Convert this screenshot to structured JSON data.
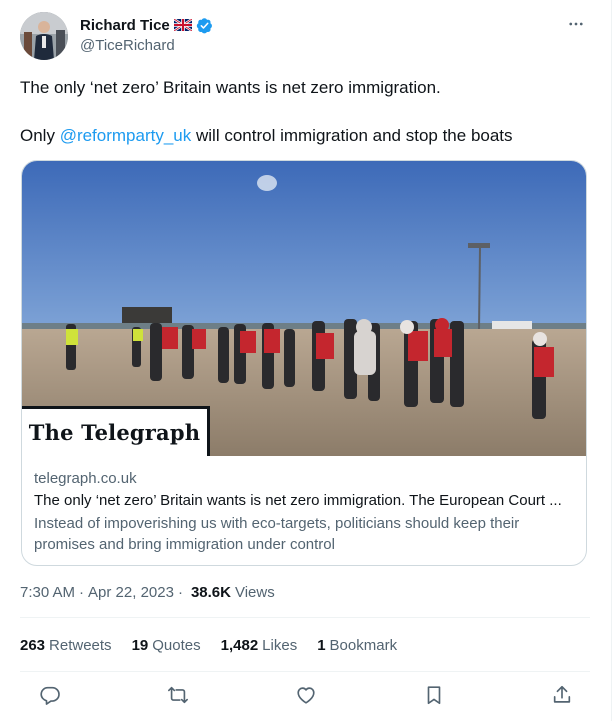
{
  "author": {
    "display_name": "Richard Tice",
    "handle": "@TiceRichard",
    "flag_icon": "union-jack-flag-icon",
    "verified_icon": "verified-badge-icon"
  },
  "tweet": {
    "line1": "The only ‘net zero’ Britain wants is net zero immigration.",
    "line2_prefix": "Only ",
    "line2_mention": "@reformparty_uk",
    "line2_suffix": " will control immigration and stop the boats"
  },
  "card": {
    "publication_label": "The Telegraph",
    "domain": "telegraph.co.uk",
    "title": "The only ‘net zero’ Britain wants is net zero immigration. The European Court ...",
    "description": "Instead of impoverishing us with eco-targets, politicians should keep their promises and bring immigration under control"
  },
  "meta": {
    "time": "7:30 AM",
    "date": "Apr 22, 2023",
    "separator": "·",
    "views_count": "38.6K",
    "views_label": "Views"
  },
  "stats": {
    "retweets_count": "263",
    "retweets_label": "Retweets",
    "quotes_count": "19",
    "quotes_label": "Quotes",
    "likes_count": "1,482",
    "likes_label": "Likes",
    "bookmarks_count": "1",
    "bookmarks_label": "Bookmark"
  },
  "actions": {
    "reply_icon": "reply-icon",
    "retweet_icon": "retweet-icon",
    "like_icon": "heart-icon",
    "bookmark_icon": "bookmark-icon",
    "share_icon": "share-icon"
  },
  "colors": {
    "link": "#1d9bf0",
    "secondary_text": "#536471",
    "primary_text": "#0f1419",
    "verified": "#1d9bf0"
  }
}
